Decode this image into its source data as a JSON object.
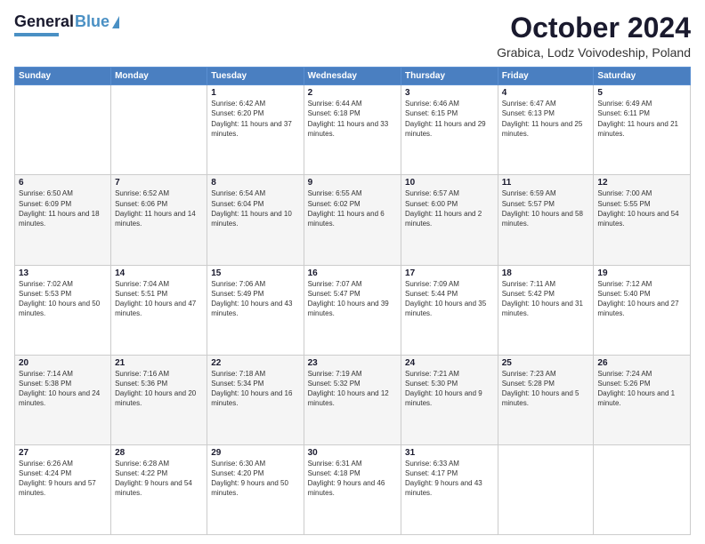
{
  "header": {
    "logo_general": "General",
    "logo_blue": "Blue",
    "title": "October 2024",
    "location": "Grabica, Lodz Voivodeship, Poland"
  },
  "weekdays": [
    "Sunday",
    "Monday",
    "Tuesday",
    "Wednesday",
    "Thursday",
    "Friday",
    "Saturday"
  ],
  "weeks": [
    [
      {
        "day": "",
        "sunrise": "",
        "sunset": "",
        "daylight": ""
      },
      {
        "day": "",
        "sunrise": "",
        "sunset": "",
        "daylight": ""
      },
      {
        "day": "1",
        "sunrise": "Sunrise: 6:42 AM",
        "sunset": "Sunset: 6:20 PM",
        "daylight": "Daylight: 11 hours and 37 minutes."
      },
      {
        "day": "2",
        "sunrise": "Sunrise: 6:44 AM",
        "sunset": "Sunset: 6:18 PM",
        "daylight": "Daylight: 11 hours and 33 minutes."
      },
      {
        "day": "3",
        "sunrise": "Sunrise: 6:46 AM",
        "sunset": "Sunset: 6:15 PM",
        "daylight": "Daylight: 11 hours and 29 minutes."
      },
      {
        "day": "4",
        "sunrise": "Sunrise: 6:47 AM",
        "sunset": "Sunset: 6:13 PM",
        "daylight": "Daylight: 11 hours and 25 minutes."
      },
      {
        "day": "5",
        "sunrise": "Sunrise: 6:49 AM",
        "sunset": "Sunset: 6:11 PM",
        "daylight": "Daylight: 11 hours and 21 minutes."
      }
    ],
    [
      {
        "day": "6",
        "sunrise": "Sunrise: 6:50 AM",
        "sunset": "Sunset: 6:09 PM",
        "daylight": "Daylight: 11 hours and 18 minutes."
      },
      {
        "day": "7",
        "sunrise": "Sunrise: 6:52 AM",
        "sunset": "Sunset: 6:06 PM",
        "daylight": "Daylight: 11 hours and 14 minutes."
      },
      {
        "day": "8",
        "sunrise": "Sunrise: 6:54 AM",
        "sunset": "Sunset: 6:04 PM",
        "daylight": "Daylight: 11 hours and 10 minutes."
      },
      {
        "day": "9",
        "sunrise": "Sunrise: 6:55 AM",
        "sunset": "Sunset: 6:02 PM",
        "daylight": "Daylight: 11 hours and 6 minutes."
      },
      {
        "day": "10",
        "sunrise": "Sunrise: 6:57 AM",
        "sunset": "Sunset: 6:00 PM",
        "daylight": "Daylight: 11 hours and 2 minutes."
      },
      {
        "day": "11",
        "sunrise": "Sunrise: 6:59 AM",
        "sunset": "Sunset: 5:57 PM",
        "daylight": "Daylight: 10 hours and 58 minutes."
      },
      {
        "day": "12",
        "sunrise": "Sunrise: 7:00 AM",
        "sunset": "Sunset: 5:55 PM",
        "daylight": "Daylight: 10 hours and 54 minutes."
      }
    ],
    [
      {
        "day": "13",
        "sunrise": "Sunrise: 7:02 AM",
        "sunset": "Sunset: 5:53 PM",
        "daylight": "Daylight: 10 hours and 50 minutes."
      },
      {
        "day": "14",
        "sunrise": "Sunrise: 7:04 AM",
        "sunset": "Sunset: 5:51 PM",
        "daylight": "Daylight: 10 hours and 47 minutes."
      },
      {
        "day": "15",
        "sunrise": "Sunrise: 7:06 AM",
        "sunset": "Sunset: 5:49 PM",
        "daylight": "Daylight: 10 hours and 43 minutes."
      },
      {
        "day": "16",
        "sunrise": "Sunrise: 7:07 AM",
        "sunset": "Sunset: 5:47 PM",
        "daylight": "Daylight: 10 hours and 39 minutes."
      },
      {
        "day": "17",
        "sunrise": "Sunrise: 7:09 AM",
        "sunset": "Sunset: 5:44 PM",
        "daylight": "Daylight: 10 hours and 35 minutes."
      },
      {
        "day": "18",
        "sunrise": "Sunrise: 7:11 AM",
        "sunset": "Sunset: 5:42 PM",
        "daylight": "Daylight: 10 hours and 31 minutes."
      },
      {
        "day": "19",
        "sunrise": "Sunrise: 7:12 AM",
        "sunset": "Sunset: 5:40 PM",
        "daylight": "Daylight: 10 hours and 27 minutes."
      }
    ],
    [
      {
        "day": "20",
        "sunrise": "Sunrise: 7:14 AM",
        "sunset": "Sunset: 5:38 PM",
        "daylight": "Daylight: 10 hours and 24 minutes."
      },
      {
        "day": "21",
        "sunrise": "Sunrise: 7:16 AM",
        "sunset": "Sunset: 5:36 PM",
        "daylight": "Daylight: 10 hours and 20 minutes."
      },
      {
        "day": "22",
        "sunrise": "Sunrise: 7:18 AM",
        "sunset": "Sunset: 5:34 PM",
        "daylight": "Daylight: 10 hours and 16 minutes."
      },
      {
        "day": "23",
        "sunrise": "Sunrise: 7:19 AM",
        "sunset": "Sunset: 5:32 PM",
        "daylight": "Daylight: 10 hours and 12 minutes."
      },
      {
        "day": "24",
        "sunrise": "Sunrise: 7:21 AM",
        "sunset": "Sunset: 5:30 PM",
        "daylight": "Daylight: 10 hours and 9 minutes."
      },
      {
        "day": "25",
        "sunrise": "Sunrise: 7:23 AM",
        "sunset": "Sunset: 5:28 PM",
        "daylight": "Daylight: 10 hours and 5 minutes."
      },
      {
        "day": "26",
        "sunrise": "Sunrise: 7:24 AM",
        "sunset": "Sunset: 5:26 PM",
        "daylight": "Daylight: 10 hours and 1 minute."
      }
    ],
    [
      {
        "day": "27",
        "sunrise": "Sunrise: 6:26 AM",
        "sunset": "Sunset: 4:24 PM",
        "daylight": "Daylight: 9 hours and 57 minutes."
      },
      {
        "day": "28",
        "sunrise": "Sunrise: 6:28 AM",
        "sunset": "Sunset: 4:22 PM",
        "daylight": "Daylight: 9 hours and 54 minutes."
      },
      {
        "day": "29",
        "sunrise": "Sunrise: 6:30 AM",
        "sunset": "Sunset: 4:20 PM",
        "daylight": "Daylight: 9 hours and 50 minutes."
      },
      {
        "day": "30",
        "sunrise": "Sunrise: 6:31 AM",
        "sunset": "Sunset: 4:18 PM",
        "daylight": "Daylight: 9 hours and 46 minutes."
      },
      {
        "day": "31",
        "sunrise": "Sunrise: 6:33 AM",
        "sunset": "Sunset: 4:17 PM",
        "daylight": "Daylight: 9 hours and 43 minutes."
      },
      {
        "day": "",
        "sunrise": "",
        "sunset": "",
        "daylight": ""
      },
      {
        "day": "",
        "sunrise": "",
        "sunset": "",
        "daylight": ""
      }
    ]
  ]
}
